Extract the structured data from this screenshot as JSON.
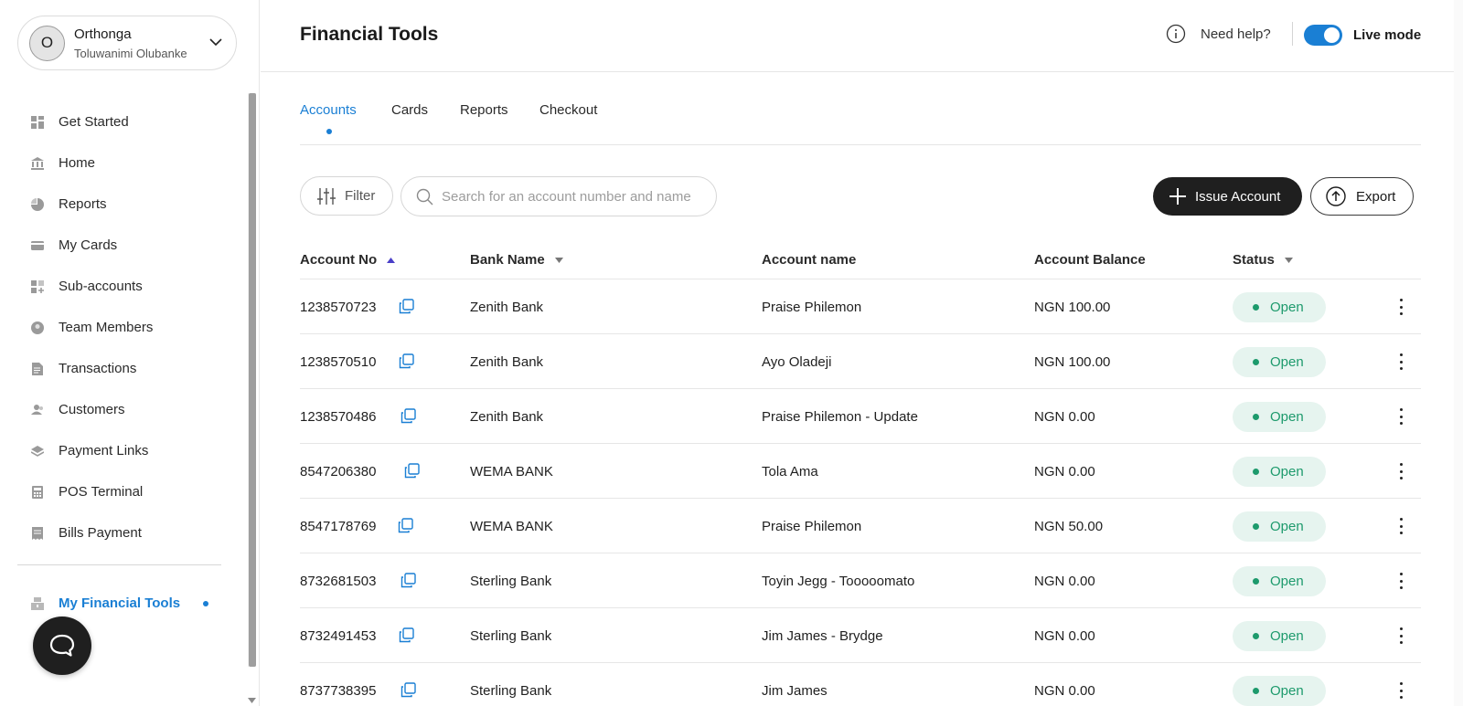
{
  "account": {
    "name": "Orthonga",
    "user": "Toluwanimi Olubanke",
    "avatar_initial": "O"
  },
  "sidebar": {
    "items": [
      {
        "label": "Get Started",
        "icon": "grid-icon"
      },
      {
        "label": "Home",
        "icon": "bank-icon"
      },
      {
        "label": "Reports",
        "icon": "pie-chart-icon"
      },
      {
        "label": "My Cards",
        "icon": "card-icon"
      },
      {
        "label": "Sub-accounts",
        "icon": "grid-plus-icon"
      },
      {
        "label": "Team Members",
        "icon": "team-icon"
      },
      {
        "label": "Transactions",
        "icon": "document-icon"
      },
      {
        "label": "Customers",
        "icon": "customers-icon"
      },
      {
        "label": "Payment Links",
        "icon": "layers-icon"
      },
      {
        "label": "POS Terminal",
        "icon": "calculator-icon"
      },
      {
        "label": "Bills Payment",
        "icon": "receipt-icon"
      }
    ],
    "active_item": {
      "label": "My Financial Tools",
      "icon": "tools-icon"
    }
  },
  "header": {
    "title": "Financial Tools",
    "help_label": "Need help?",
    "live_mode_label": "Live mode",
    "live_mode_on": true
  },
  "tabs": [
    {
      "label": "Accounts",
      "active": true
    },
    {
      "label": "Cards",
      "active": false
    },
    {
      "label": "Reports",
      "active": false
    },
    {
      "label": "Checkout",
      "active": false
    }
  ],
  "toolbar": {
    "filter_label": "Filter",
    "search_placeholder": "Search for an account number and name",
    "issue_label": "Issue Account",
    "export_label": "Export"
  },
  "table": {
    "columns": [
      "Account No",
      "Bank Name",
      "Account name",
      "Account Balance",
      "Status"
    ],
    "rows": [
      {
        "account_no": "1238570723",
        "bank": "Zenith Bank",
        "name": "Praise Philemon",
        "balance": "NGN 100.00",
        "status": "Open"
      },
      {
        "account_no": "1238570510",
        "bank": "Zenith Bank",
        "name": "Ayo Oladeji",
        "balance": "NGN 100.00",
        "status": "Open"
      },
      {
        "account_no": "1238570486",
        "bank": "Zenith Bank",
        "name": "Praise Philemon - Update",
        "balance": "NGN 0.00",
        "status": "Open"
      },
      {
        "account_no": "8547206380",
        "bank": "WEMA BANK",
        "name": "Tola Ama",
        "balance": "NGN 0.00",
        "status": "Open"
      },
      {
        "account_no": "8547178769",
        "bank": "WEMA BANK",
        "name": "Praise Philemon",
        "balance": "NGN 50.00",
        "status": "Open"
      },
      {
        "account_no": "8732681503",
        "bank": "Sterling Bank",
        "name": "Toyin Jegg - Tooooomato",
        "balance": "NGN 0.00",
        "status": "Open"
      },
      {
        "account_no": "8732491453",
        "bank": "Sterling Bank",
        "name": "Jim James - Brydge",
        "balance": "NGN 0.00",
        "status": "Open"
      },
      {
        "account_no": "8737738395",
        "bank": "Sterling Bank",
        "name": "Jim James",
        "balance": "NGN 0.00",
        "status": "Open"
      }
    ]
  },
  "colors": {
    "accent": "#1a7fd4",
    "status_open": "#1d9a6c",
    "status_open_bg": "#e6f4ef",
    "dark_button": "#1f1f1f"
  }
}
